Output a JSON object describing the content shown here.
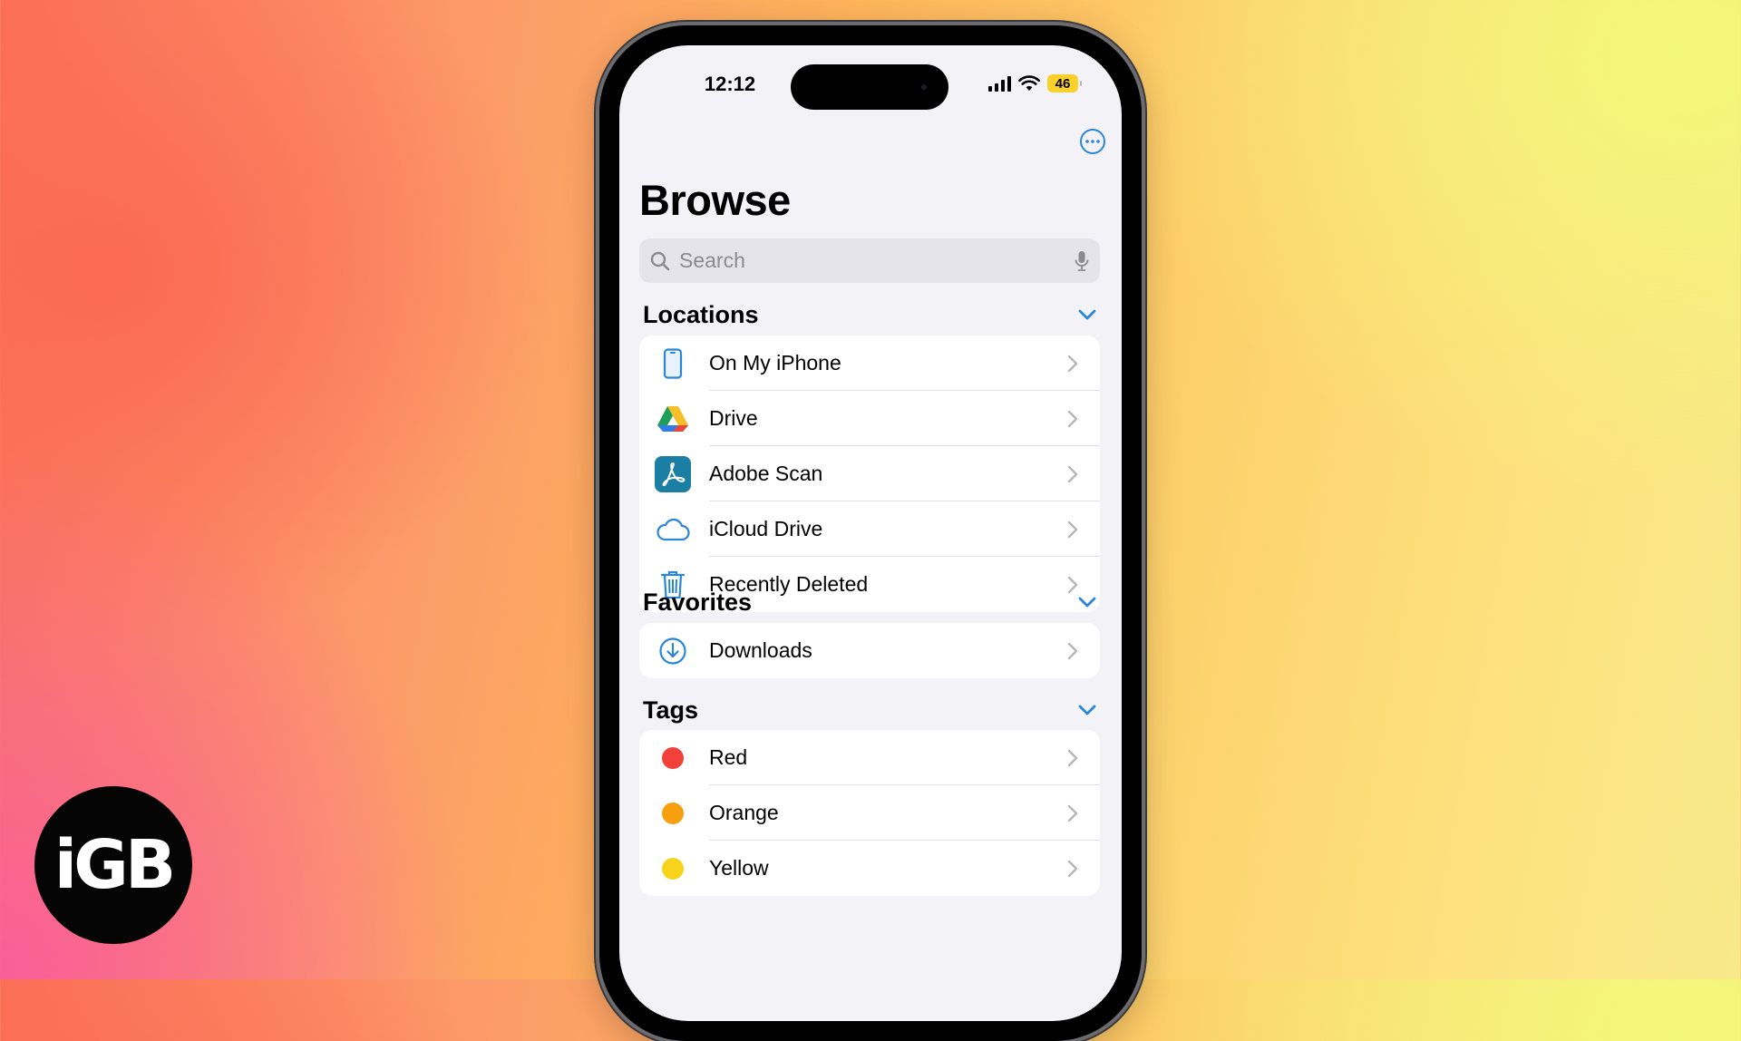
{
  "brand": {
    "logo_text": "iGB"
  },
  "status_bar": {
    "time": "12:12",
    "battery": "46"
  },
  "header": {
    "title": "Browse"
  },
  "search": {
    "placeholder": "Search"
  },
  "sections": {
    "locations": {
      "title": "Locations",
      "items": [
        {
          "label": "On My iPhone",
          "icon": "iphone-icon"
        },
        {
          "label": "Drive",
          "icon": "google-drive-icon"
        },
        {
          "label": "Adobe Scan",
          "icon": "adobe-scan-icon"
        },
        {
          "label": "iCloud Drive",
          "icon": "icloud-icon"
        },
        {
          "label": "Recently Deleted",
          "icon": "trash-icon"
        }
      ]
    },
    "favorites": {
      "title": "Favorites",
      "items": [
        {
          "label": "Downloads",
          "icon": "download-icon"
        }
      ]
    },
    "tags": {
      "title": "Tags",
      "items": [
        {
          "label": "Red",
          "color": "#f2403a"
        },
        {
          "label": "Orange",
          "color": "#f7a00f"
        },
        {
          "label": "Yellow",
          "color": "#f9d21c"
        }
      ]
    }
  },
  "colors": {
    "accent": "#2a86d8",
    "background": "#f2f2f7"
  }
}
